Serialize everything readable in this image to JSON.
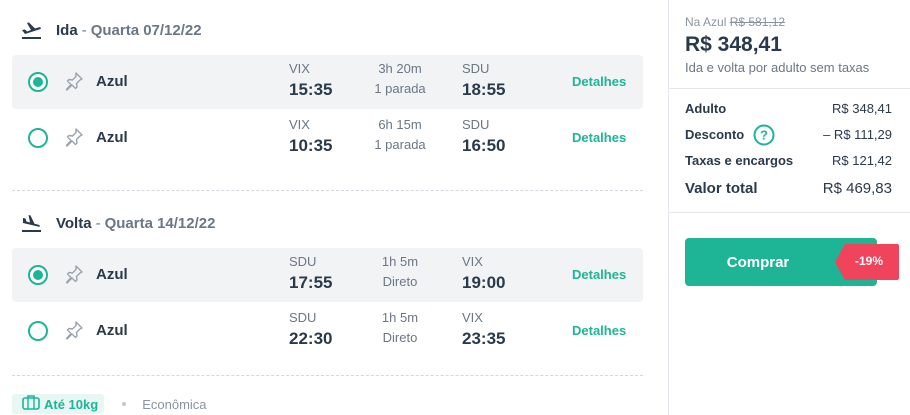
{
  "outbound": {
    "title": "Ida",
    "separator": "-",
    "date": "Quarta 07/12/22",
    "flights": [
      {
        "selected": true,
        "airline": "Azul",
        "from_code": "VIX",
        "dep_time": "15:35",
        "duration": "3h 20m",
        "stops": "1 parada",
        "to_code": "SDU",
        "arr_time": "18:55",
        "details": "Detalhes"
      },
      {
        "selected": false,
        "airline": "Azul",
        "from_code": "VIX",
        "dep_time": "10:35",
        "duration": "6h 15m",
        "stops": "1 parada",
        "to_code": "SDU",
        "arr_time": "16:50",
        "details": "Detalhes"
      }
    ]
  },
  "return": {
    "title": "Volta",
    "separator": "-",
    "date": "Quarta 14/12/22",
    "flights": [
      {
        "selected": true,
        "airline": "Azul",
        "from_code": "SDU",
        "dep_time": "17:55",
        "duration": "1h 5m",
        "stops": "Direto",
        "to_code": "VIX",
        "arr_time": "19:00",
        "details": "Detalhes"
      },
      {
        "selected": false,
        "airline": "Azul",
        "from_code": "SDU",
        "dep_time": "22:30",
        "duration": "1h 5m",
        "stops": "Direto",
        "to_code": "VIX",
        "arr_time": "23:35",
        "details": "Detalhes"
      }
    ]
  },
  "footer": {
    "baggage": "Até 10kg",
    "cabin": "Econômica"
  },
  "summary": {
    "original_prefix": "Na Azul",
    "original_price": "R$ 581,12",
    "price": "R$ 348,41",
    "price_note": "Ida e volta por adulto sem taxas",
    "breakdown": [
      {
        "label": "Adulto",
        "value": "R$ 348,41"
      },
      {
        "label": "Desconto",
        "value": "– R$ 111,29"
      },
      {
        "label": "Taxas e encargos",
        "value": "R$ 121,42"
      }
    ],
    "total_label": "Valor total",
    "total_value": "R$ 469,83",
    "buy_label": "Comprar",
    "discount_badge": "-19%"
  },
  "colors": {
    "accent": "#1eb596",
    "badge": "#f0435c",
    "text": "#2b3a4a",
    "muted": "#6b7785",
    "selected_row": "#f1f3f5"
  }
}
